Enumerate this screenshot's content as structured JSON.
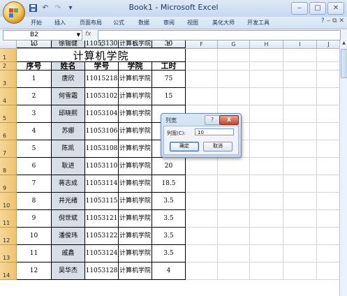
{
  "window": {
    "title": "Book1 - Microsoft Excel"
  },
  "quick_access": {
    "save_icon": "save-icon",
    "undo_icon": "undo-icon",
    "redo_icon": "redo-icon"
  },
  "window_controls": {
    "minimize": "‒",
    "maximize": "□",
    "close": "✕"
  },
  "ribbon": {
    "tabs": [
      "开始",
      "插入",
      "页面布局",
      "公式",
      "数据",
      "审阅",
      "视图",
      "美化大师",
      "开发工具"
    ],
    "help": "?",
    "mini_controls": "‒ ⧉ ✕"
  },
  "formula_bar": {
    "name_box": "B2",
    "fx_label": "fx",
    "value": ""
  },
  "columns": [
    "A",
    "B",
    "C",
    "D",
    "E",
    "F",
    "G",
    "H",
    "I",
    "J"
  ],
  "selected_column": "B",
  "row_numbers": [
    "1",
    "2",
    "3",
    "4",
    "5",
    "6",
    "7",
    "8",
    "9",
    "10",
    "11",
    "12",
    "13",
    "14"
  ],
  "sheet": {
    "title": "计算机学院",
    "headers": [
      "序号",
      "姓名",
      "学号",
      "学院",
      "工时"
    ],
    "rows": [
      {
        "no": "1",
        "name": "唐欣",
        "id": "11015218",
        "college": "计算机学院",
        "hours": "75"
      },
      {
        "no": "2",
        "name": "何雪霜",
        "id": "11053102",
        "college": "计算机学院",
        "hours": "15"
      },
      {
        "no": "3",
        "name": "邱晓熙",
        "id": "11053104",
        "college": "计算机学院",
        "hours": ""
      },
      {
        "no": "4",
        "name": "苏娜",
        "id": "11053106",
        "college": "计算机学院",
        "hours": ""
      },
      {
        "no": "5",
        "name": "陈凯",
        "id": "11053108",
        "college": "计算机学院",
        "hours": ""
      },
      {
        "no": "6",
        "name": "耿进",
        "id": "11053110",
        "college": "计算机学院",
        "hours": "20"
      },
      {
        "no": "7",
        "name": "蒋志成",
        "id": "11053114",
        "college": "计算机学院",
        "hours": "18.5"
      },
      {
        "no": "8",
        "name": "井光绪",
        "id": "11053115",
        "college": "计算机学院",
        "hours": "3.5"
      },
      {
        "no": "9",
        "name": "倪世斌",
        "id": "11053121",
        "college": "计算机学院",
        "hours": "3.5"
      },
      {
        "no": "10",
        "name": "潘俊玮",
        "id": "11053122",
        "college": "计算机学院",
        "hours": "3.5"
      },
      {
        "no": "11",
        "name": "戚鑫",
        "id": "11053124",
        "college": "计算机学院",
        "hours": "3.5"
      },
      {
        "no": "12",
        "name": "吴华杰",
        "id": "11053128",
        "college": "计算机学院",
        "hours": "4"
      },
      {
        "no": "13",
        "name": "徐锡健",
        "id": "11053130",
        "college": "计算机学院",
        "hours": "30"
      }
    ]
  },
  "dialog": {
    "title": "列宽",
    "help": "?",
    "close": "X",
    "field_label": "列宽(C):",
    "field_value": "10",
    "ok_label": "确定",
    "cancel_label": "取消"
  }
}
